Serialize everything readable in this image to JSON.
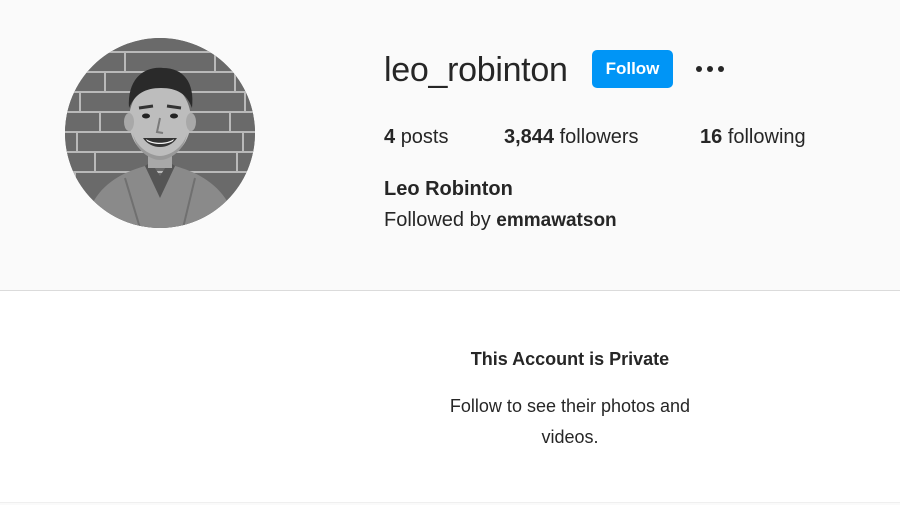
{
  "profile": {
    "username": "leo_robinton",
    "follow_label": "Follow",
    "more_icon": "more-horizontal-icon",
    "stats": {
      "posts_count": "4",
      "posts_label": "posts",
      "followers_count": "3,844",
      "followers_label": "followers",
      "following_count": "16",
      "following_label": "following"
    },
    "full_name": "Leo Robinton",
    "followed_by_prefix": "Followed by",
    "followed_by_user": "emmawatson"
  },
  "private_notice": {
    "title": "This Account is Private",
    "message": "Follow to see their photos and videos."
  },
  "colors": {
    "accent": "#0095f6",
    "text": "#262626",
    "header_bg": "#fafafa",
    "panel_bg": "#ffffff",
    "divider": "#dbdbdb"
  }
}
